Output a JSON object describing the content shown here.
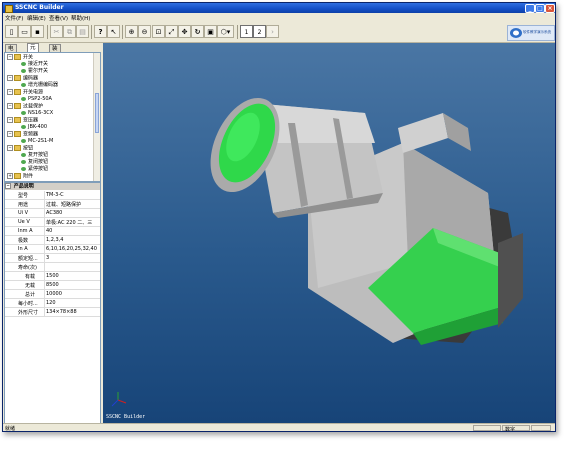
{
  "window": {
    "title": "SSCNC Builder"
  },
  "menu": [
    "文件(F)",
    "编辑(E)",
    "查看(V)",
    "帮助(H)"
  ],
  "toolbar": {
    "file_buttons": [
      "new",
      "open",
      "save"
    ],
    "edit_buttons": [
      "cut",
      "copy",
      "paste"
    ],
    "help_label": "?",
    "view_buttons": [
      "zoom-in",
      "zoom-out",
      "zoom-box",
      "fit",
      "pan",
      "rotate",
      "reset-view"
    ],
    "pages": [
      "1",
      "2"
    ],
    "next_label": "›"
  },
  "logo": {
    "text": "软件教学演示系统"
  },
  "tabs": [
    "电路图",
    "元器件",
    "装配"
  ],
  "tree": [
    {
      "level": 0,
      "label": "开关",
      "kind": "folder",
      "expanded": true
    },
    {
      "level": 1,
      "label": "接近开关",
      "kind": "item"
    },
    {
      "level": 1,
      "label": "霍尔开关",
      "kind": "item"
    },
    {
      "level": 0,
      "label": "编码器",
      "kind": "folder",
      "expanded": true
    },
    {
      "level": 1,
      "label": "增光栅编码器",
      "kind": "item"
    },
    {
      "level": 0,
      "label": "开关电源",
      "kind": "folder",
      "expanded": true
    },
    {
      "level": 1,
      "label": "PSP2-50A",
      "kind": "item"
    },
    {
      "level": 0,
      "label": "过载保护",
      "kind": "folder",
      "expanded": true
    },
    {
      "level": 1,
      "label": "NS16-3CX",
      "kind": "item"
    },
    {
      "level": 0,
      "label": "变压器",
      "kind": "folder",
      "expanded": true
    },
    {
      "level": 1,
      "label": "JBK-400",
      "kind": "item"
    },
    {
      "level": 0,
      "label": "变频器",
      "kind": "folder",
      "expanded": true
    },
    {
      "level": 1,
      "label": "MC-2S1-M",
      "kind": "item"
    },
    {
      "level": 0,
      "label": "按钮",
      "kind": "folder",
      "expanded": true
    },
    {
      "level": 1,
      "label": "复开按钮",
      "kind": "item"
    },
    {
      "level": 1,
      "label": "复闭按钮",
      "kind": "item"
    },
    {
      "level": 1,
      "label": "紧停按钮",
      "kind": "item"
    },
    {
      "level": 0,
      "label": "附件",
      "kind": "folder",
      "expanded": false
    }
  ],
  "properties": {
    "header": "产品说明",
    "rows": [
      {
        "key": "型号",
        "value": "TM-3-C"
      },
      {
        "key": "用途",
        "value": "过载、短路保护"
      },
      {
        "key": "Ui V",
        "value": "AC380"
      },
      {
        "key": "Ue V",
        "value": "单极:AC 220  二、三"
      },
      {
        "key": "Inm A",
        "value": "40"
      },
      {
        "key": "极数",
        "value": "1,2,3,4"
      },
      {
        "key": "In A",
        "value": "6,10,16,20,25,32,40"
      },
      {
        "key": "额定短...",
        "value": "3"
      },
      {
        "key": "寿命(次)",
        "value": ""
      },
      {
        "key": "有载",
        "value": "1500",
        "indent": true
      },
      {
        "key": "无载",
        "value": "8500",
        "indent": true
      },
      {
        "key": "总计",
        "value": "10000",
        "indent": true
      },
      {
        "key": "每小时...",
        "value": "120"
      },
      {
        "key": "外形尺寸",
        "value": "134×78×88"
      }
    ]
  },
  "viewport": {
    "label": "SSCNC Builder",
    "model": "3D circuit breaker with green button"
  },
  "status": {
    "left": "就绪",
    "right": "数字"
  },
  "colors": {
    "title_bar": "#1450c8",
    "viewport_bg": "#2a5a8d",
    "model_green": "#2fd84a",
    "model_grey": "#c8c8c8"
  }
}
